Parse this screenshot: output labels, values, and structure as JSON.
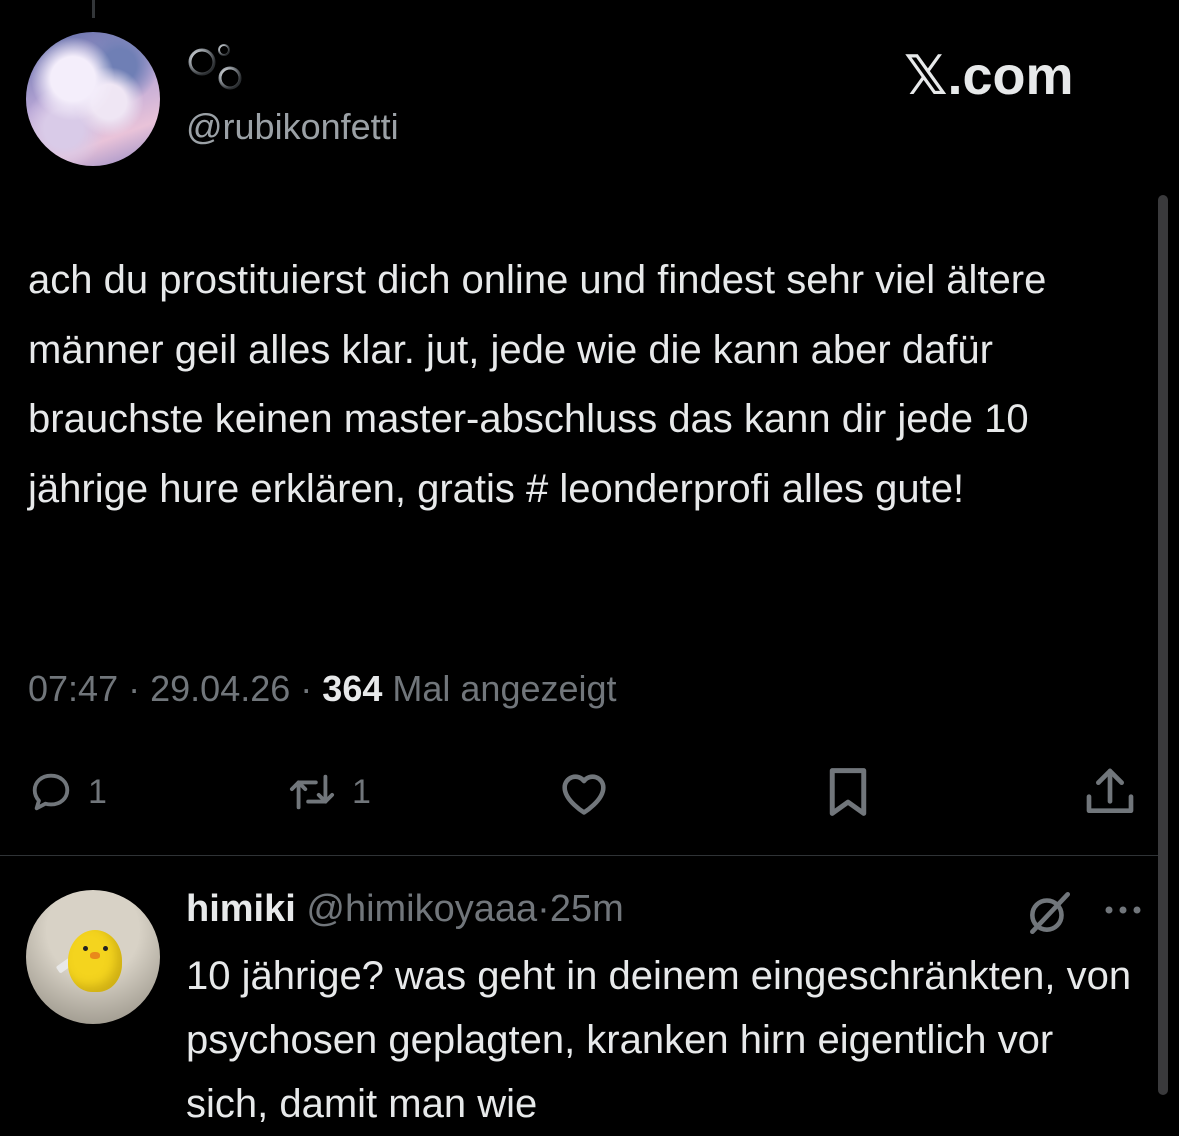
{
  "brand": {
    "label": "𝕏.com"
  },
  "tweet": {
    "handle": "@rubikonfetti",
    "text": "ach du prostituierst dich online und findest sehr viel ältere männer geil alles klar. jut, jede wie die kann aber dafür brauchste keinen master-abschluss das kann dir jede 10 jährige hure erklären, gratis # leonderprofi alles gute!",
    "time": "07:47",
    "separator": "·",
    "date": "29.04.26",
    "views_count": "364",
    "views_label": "Mal angezeigt"
  },
  "actions": {
    "reply_count": "1",
    "retweet_count": "1"
  },
  "reply": {
    "name": "himiki",
    "handle": "@himikoyaaa",
    "separator": "·",
    "time": "25m",
    "text": "10 jährige? was geht in deinem eingeschränkten, von psychosen geplagten, kranken hirn eigentlich vor sich, damit man wie"
  },
  "colors": {
    "background": "#000000",
    "text_primary": "#e7e9ea",
    "text_secondary": "#71767b"
  },
  "icons": [
    "bubbles-emoji-icon",
    "reply-icon",
    "retweet-icon",
    "like-icon",
    "bookmark-icon",
    "share-icon",
    "grok-icon",
    "more-icon"
  ]
}
